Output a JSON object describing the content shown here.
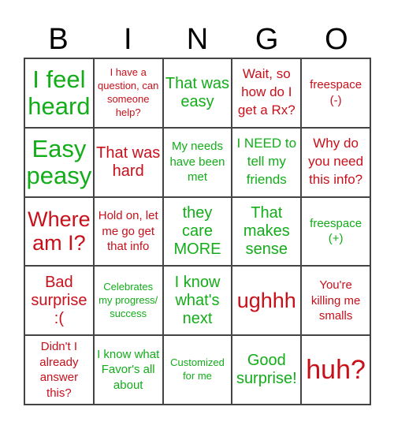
{
  "header": {
    "letters": [
      "B",
      "I",
      "N",
      "G",
      "O"
    ]
  },
  "colors": {
    "positive": "#13ad1a",
    "negative": "#c8101b"
  },
  "cells": [
    {
      "text": "I feel heard",
      "tone": "green",
      "size": "s-xl"
    },
    {
      "text": "I have a question, can someone help?",
      "tone": "red",
      "size": "s-xs"
    },
    {
      "text": "That was easy",
      "tone": "green",
      "size": "s-m"
    },
    {
      "text": "Wait, so how do I get a Rx?",
      "tone": "red",
      "size": "s-ms"
    },
    {
      "text": "freespace (-)",
      "tone": "red",
      "size": "s-s"
    },
    {
      "text": "Easy peasy",
      "tone": "green",
      "size": "s-xl"
    },
    {
      "text": "That was hard",
      "tone": "red",
      "size": "s-m"
    },
    {
      "text": "My needs have been met",
      "tone": "green",
      "size": "s-s"
    },
    {
      "text": "I NEED to tell my friends",
      "tone": "green",
      "size": "s-ms"
    },
    {
      "text": "Why do you need this info?",
      "tone": "red",
      "size": "s-ms"
    },
    {
      "text": "Where am I?",
      "tone": "red",
      "size": "s-l"
    },
    {
      "text": "Hold on, let me go get that info",
      "tone": "red",
      "size": "s-s"
    },
    {
      "text": "they care MORE",
      "tone": "green",
      "size": "s-m"
    },
    {
      "text": "That makes sense",
      "tone": "green",
      "size": "s-m"
    },
    {
      "text": "freespace (+)",
      "tone": "green",
      "size": "s-s"
    },
    {
      "text": "Bad surprise :(",
      "tone": "red",
      "size": "s-m"
    },
    {
      "text": "Celebrates my progress/ success",
      "tone": "green",
      "size": "s-xs"
    },
    {
      "text": "I know what's next",
      "tone": "green",
      "size": "s-m"
    },
    {
      "text": "ughhh",
      "tone": "red",
      "size": "s-l"
    },
    {
      "text": "You're killing me smalls",
      "tone": "red",
      "size": "s-s"
    },
    {
      "text": "Didn't I already answer this?",
      "tone": "red",
      "size": "s-s"
    },
    {
      "text": "I know what Favor's all about",
      "tone": "green",
      "size": "s-s"
    },
    {
      "text": "Customized for me",
      "tone": "green",
      "size": "s-xs"
    },
    {
      "text": "Good surprise!",
      "tone": "green",
      "size": "s-m"
    },
    {
      "text": "huh?",
      "tone": "red",
      "size": "s-xxl"
    }
  ]
}
